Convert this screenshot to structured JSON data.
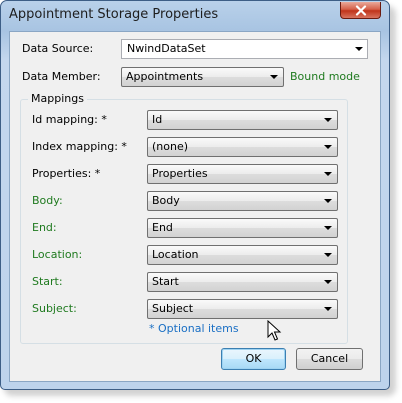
{
  "window": {
    "title": "Appointment Storage Properties",
    "close_icon": "close-icon"
  },
  "data_source": {
    "label": "Data Source:",
    "value": "NwindDataSet"
  },
  "data_member": {
    "label": "Data Member:",
    "value": "Appointments",
    "mode_text": "Bound mode"
  },
  "mappings": {
    "title": "Mappings",
    "rows": [
      {
        "label": "Id mapping: *",
        "value": "Id",
        "optional": false
      },
      {
        "label": "Index mapping: *",
        "value": "(none)",
        "optional": false
      },
      {
        "label": "Properties: *",
        "value": "Properties",
        "optional": false
      },
      {
        "label": "Body:",
        "value": "Body",
        "optional": true
      },
      {
        "label": "End:",
        "value": "End",
        "optional": true
      },
      {
        "label": "Location:",
        "value": "Location",
        "optional": true
      },
      {
        "label": "Start:",
        "value": "Start",
        "optional": true
      },
      {
        "label": "Subject:",
        "value": "Subject",
        "optional": true
      }
    ],
    "optional_note": "* Optional items"
  },
  "buttons": {
    "ok": "OK",
    "cancel": "Cancel"
  },
  "colors": {
    "optional_label": "#1f7a1f",
    "link": "#1a6fc4",
    "close_button": "#c0341a"
  }
}
